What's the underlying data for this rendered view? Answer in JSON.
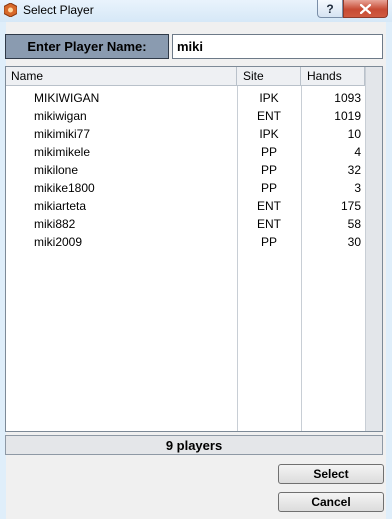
{
  "window": {
    "title": "Select Player",
    "help_glyph": "?",
    "close_glyph": "✕"
  },
  "search": {
    "label": "Enter Player Name:",
    "value": "miki"
  },
  "table": {
    "headers": [
      "Name",
      "Site",
      "Hands"
    ],
    "rows": [
      {
        "name": "MIKIWIGAN",
        "site": "IPK",
        "hands": "1093"
      },
      {
        "name": "mikiwigan",
        "site": "ENT",
        "hands": "1019"
      },
      {
        "name": "mikimiki77",
        "site": "IPK",
        "hands": "10"
      },
      {
        "name": "mikimikele",
        "site": "PP",
        "hands": "4"
      },
      {
        "name": "mikilone",
        "site": "PP",
        "hands": "32"
      },
      {
        "name": "mikike1800",
        "site": "PP",
        "hands": "3"
      },
      {
        "name": "mikiarteta",
        "site": "ENT",
        "hands": "175"
      },
      {
        "name": "miki882",
        "site": "ENT",
        "hands": "58"
      },
      {
        "name": "miki2009",
        "site": "PP",
        "hands": "30"
      }
    ]
  },
  "status": {
    "count_text": "9 players"
  },
  "buttons": {
    "select_label": "Select",
    "cancel_label": "Cancel"
  },
  "colors": {
    "label_bg": "#8a9bb0",
    "close_button": "#c74b34",
    "frame": "#dfeefa"
  }
}
